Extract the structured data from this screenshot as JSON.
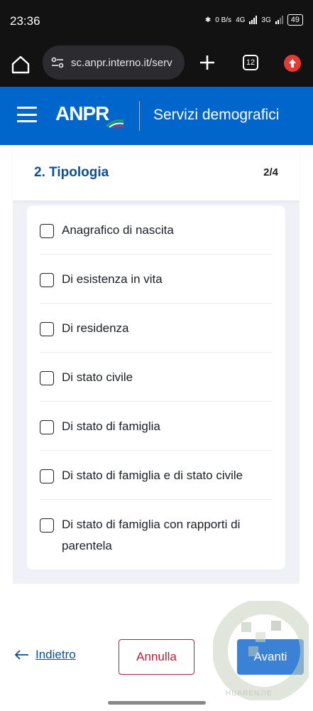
{
  "status_bar": {
    "time": "23:36",
    "net_speed": "0 B/s",
    "net1": "4G",
    "net2": "3G",
    "battery": "49"
  },
  "browser": {
    "url": "sc.anpr.interno.it/serv",
    "tab_count": "12"
  },
  "header": {
    "logo_text": "ANPR",
    "title": "Servizi demografici"
  },
  "step": {
    "title": "2. Tipologia",
    "counter": "2/4"
  },
  "options": [
    {
      "label": "Anagrafico di nascita",
      "checked": false
    },
    {
      "label": "Di esistenza in vita",
      "checked": false
    },
    {
      "label": "Di residenza",
      "checked": false
    },
    {
      "label": "Di stato civile",
      "checked": false
    },
    {
      "label": "Di stato di famiglia",
      "checked": false
    },
    {
      "label": "Di stato di famiglia e di stato civile",
      "checked": false
    },
    {
      "label": "Di stato di famiglia con rapporti di parentela",
      "checked": false
    }
  ],
  "footer": {
    "back_label": "Indietro",
    "cancel_label": "Annulla",
    "next_label": "Avanti"
  },
  "watermark": {
    "text": "HUARENJIE"
  },
  "colors": {
    "primary": "#0066cc",
    "step_title": "#0b4f96",
    "danger": "#b71c3c",
    "next_button": "#3b82d6"
  }
}
